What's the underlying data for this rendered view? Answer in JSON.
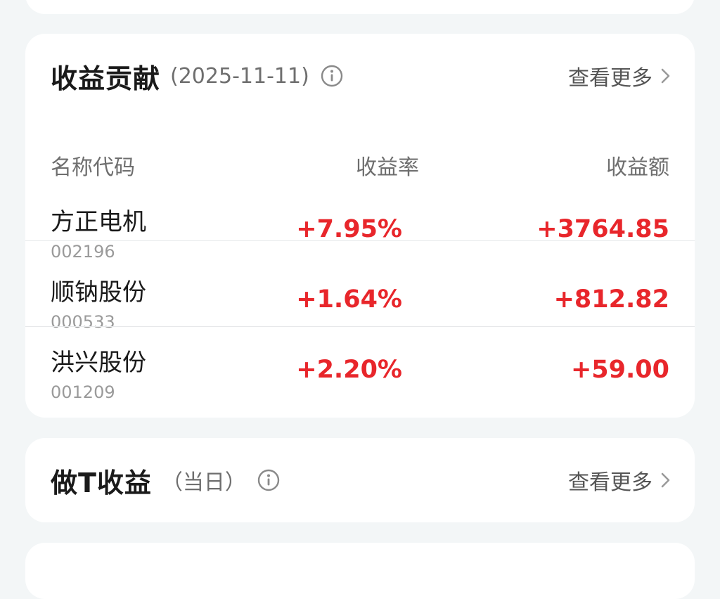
{
  "contribution": {
    "title": "收益贡献",
    "date": "(2025-11-11)",
    "more_label": "查看更多",
    "columns": {
      "name": "名称代码",
      "rate": "收益率",
      "amount": "收益额"
    },
    "rows": [
      {
        "name": "方正电机",
        "code": "002196",
        "rate": "+7.95%",
        "amount": "+3764.85"
      },
      {
        "name": "顺钠股份",
        "code": "000533",
        "rate": "+1.64%",
        "amount": "+812.82"
      },
      {
        "name": "洪兴股份",
        "code": "001209",
        "rate": "+2.20%",
        "amount": "+59.00"
      }
    ]
  },
  "do_t": {
    "title": "做T收益",
    "period": "（当日）",
    "more_label": "查看更多"
  },
  "colors": {
    "gain_red": "#e8262b",
    "background": "#f3f6f7",
    "card": "#ffffff"
  },
  "icons": {
    "info": "info-circle-icon",
    "more": "chevron-right-icon"
  }
}
